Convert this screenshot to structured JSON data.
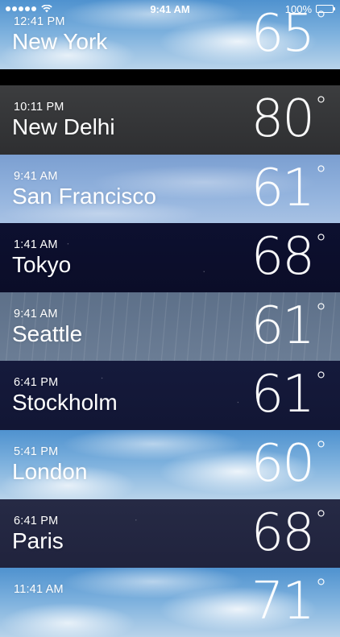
{
  "status_bar": {
    "time": "9:41 AM",
    "battery": "100%",
    "signal_bars": 5
  },
  "cities": [
    {
      "time": "12:41 PM",
      "city": "New York",
      "temp": "65",
      "degree": "°",
      "background": "sky"
    },
    {
      "time": "10:11 PM",
      "city": "New Delhi",
      "temp": "80",
      "degree": "°",
      "background": "dark-gray"
    },
    {
      "time": "9:41 AM",
      "city": "San Francisco",
      "temp": "61",
      "degree": "°",
      "background": "light-blue"
    },
    {
      "time": "1:41 AM",
      "city": "Tokyo",
      "temp": "68",
      "degree": "°",
      "background": "night"
    },
    {
      "time": "9:41 AM",
      "city": "Seattle",
      "temp": "61",
      "degree": "°",
      "background": "rain"
    },
    {
      "time": "6:41 PM",
      "city": "Stockholm",
      "temp": "61",
      "degree": "°",
      "background": "night"
    },
    {
      "time": "5:41 PM",
      "city": "London",
      "temp": "60",
      "degree": "°",
      "background": "sky"
    },
    {
      "time": "6:41 PM",
      "city": "Paris",
      "temp": "68",
      "degree": "°",
      "background": "night"
    },
    {
      "time": "11:41 AM",
      "city": "",
      "temp": "71",
      "degree": "°",
      "background": "sky"
    }
  ]
}
